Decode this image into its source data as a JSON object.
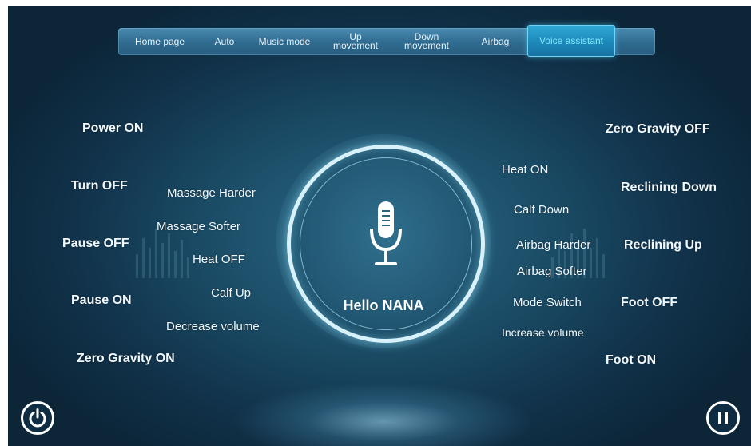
{
  "nav": {
    "tabs": [
      {
        "label": "Home page"
      },
      {
        "label": "Auto"
      },
      {
        "label": "Music mode"
      },
      {
        "label": "Up\nmovement"
      },
      {
        "label": "Down\nmovement"
      },
      {
        "label": "Airbag"
      },
      {
        "label": "Voice assistant"
      }
    ],
    "active_tab": "Voice assistant"
  },
  "commands_left": {
    "power_on": "Power  ON",
    "turn_off": "Turn OFF",
    "pause_off": "Pause OFF",
    "pause_on": "Pause ON",
    "zero_gravity_on": "Zero Gravity ON",
    "massage_harder": "Massage Harder",
    "massage_softer": "Massage Softer",
    "heat_off": "Heat OFF",
    "calf_up": "Calf Up",
    "decrease_volume": "Decrease volume"
  },
  "commands_right": {
    "zero_gravity_off": "Zero Gravity OFF",
    "heat_on": "Heat ON",
    "reclining_down": "Reclining Down",
    "calf_down": "Calf Down",
    "airbag_harder": "Airbag Harder",
    "reclining_up": "Reclining Up",
    "airbag_softer": "Airbag Softer",
    "mode_switch": "Mode Switch",
    "foot_off": "Foot OFF",
    "increase_volume": "Increase volume",
    "foot_on": "Foot ON"
  },
  "center": {
    "greeting": "Hello NANA",
    "icon": "microphone-icon"
  },
  "buttons": {
    "power_icon": "power-icon",
    "pause_icon": "pause-icon"
  },
  "colors": {
    "accent": "#7fe8ff",
    "background": "#1a4a64",
    "ring": "#d8f2fb"
  }
}
